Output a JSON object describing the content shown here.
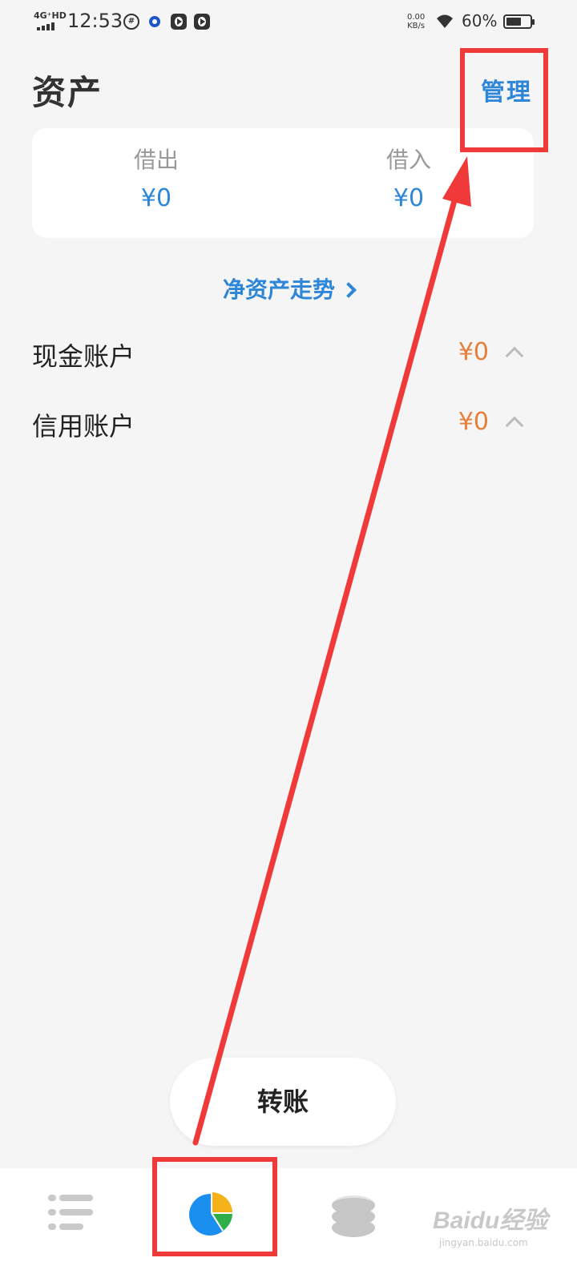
{
  "status_bar": {
    "network": "4G⁺HD",
    "time": "12:53",
    "speed_value": "0.00",
    "speed_unit": "KB/s",
    "battery_percent": "60%"
  },
  "header": {
    "title": "资产",
    "manage_label": "管理"
  },
  "summary_card": {
    "lent_label": "借出",
    "lent_value": "¥0",
    "borrowed_label": "借入",
    "borrowed_value": "¥0"
  },
  "trend_link": "净资产走势",
  "accounts": [
    {
      "name": "现金账户",
      "amount": "¥0"
    },
    {
      "name": "信用账户",
      "amount": "¥0"
    }
  ],
  "transfer_button": "转账",
  "tabbar": {
    "tabs": [
      "list-icon",
      "pie-chart-icon",
      "coins-icon",
      "paw-icon"
    ],
    "active_index": 1
  },
  "watermark": {
    "brand": "Baidu经验",
    "url": "jingyan.baidu.com"
  },
  "colors": {
    "accent_blue": "#2e86d8",
    "amount_orange": "#e67e3a",
    "annotation_red": "#f03a3a"
  }
}
